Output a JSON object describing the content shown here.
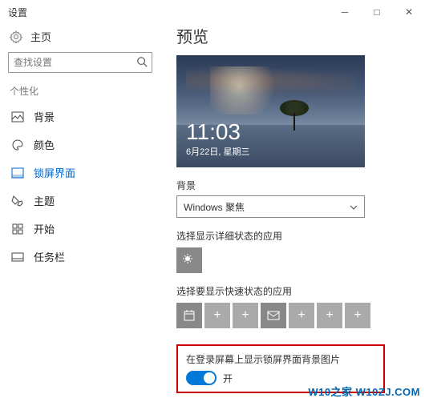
{
  "titlebar": {
    "title": "设置"
  },
  "home": {
    "label": "主页"
  },
  "search": {
    "placeholder": "查找设置"
  },
  "section": {
    "label": "个性化"
  },
  "nav": {
    "background": "背景",
    "colors": "颜色",
    "lockscreen": "锁屏界面",
    "themes": "主题",
    "start": "开始",
    "taskbar": "任务栏"
  },
  "preview": {
    "heading": "预览",
    "time": "11:03",
    "date": "6月22日, 星期三"
  },
  "bg_section": {
    "label": "背景",
    "selected": "Windows 聚焦"
  },
  "detail_status": {
    "label": "选择显示详细状态的应用"
  },
  "quick_status": {
    "label": "选择要显示快速状态的应用"
  },
  "login_bg": {
    "label": "在登录屏幕上显示锁屏界面背景图片",
    "state": "开"
  },
  "watermark": "W10之家 W10ZJ.COM"
}
